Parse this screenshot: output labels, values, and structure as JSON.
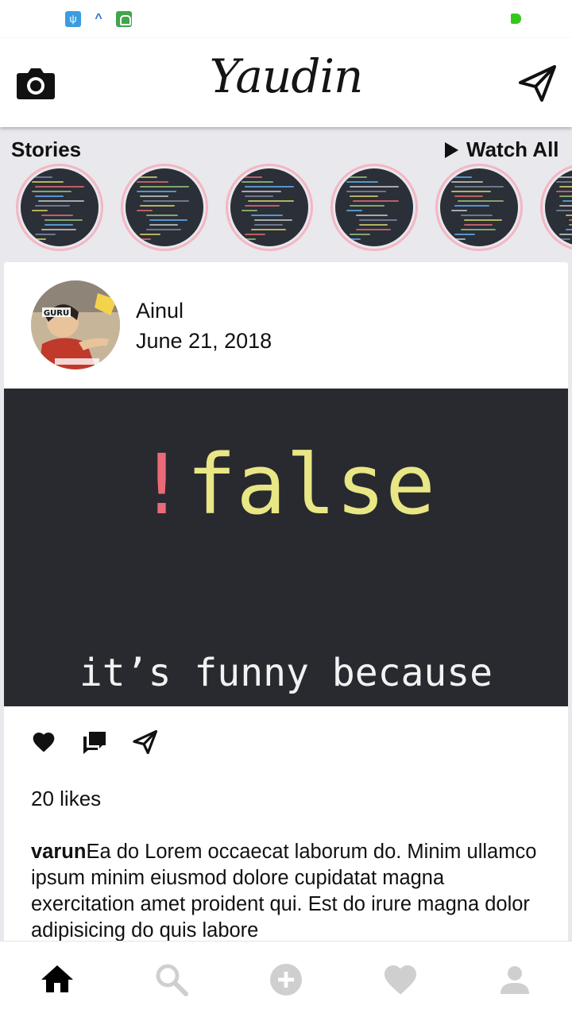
{
  "status_bar": {
    "icons": [
      "usb-icon",
      "caret-up-icon",
      "android-icon",
      "battery-icon"
    ],
    "colors": {
      "usb": "#3b9ce0",
      "android": "#3fa64a",
      "battery": "#34c81e"
    }
  },
  "app_bar": {
    "title": "Yaudin",
    "left_icon": "camera-icon",
    "right_icon": "send-icon"
  },
  "stories": {
    "label": "Stories",
    "watch_all": "Watch All",
    "items": [
      {
        "ring_color": "#f4b6c2"
      },
      {
        "ring_color": "#f4b6c2"
      },
      {
        "ring_color": "#f4b6c2"
      },
      {
        "ring_color": "#f4b6c2"
      },
      {
        "ring_color": "#f4b6c2"
      },
      {
        "ring_color": "#f4b6c2"
      }
    ]
  },
  "post": {
    "author": "Ainul",
    "date": "June 21, 2018",
    "avatar_text": "GURU",
    "image": {
      "bang": "!",
      "main_text": "false",
      "sub_text": "it’s funny because",
      "bg_color": "#282a30"
    },
    "actions": [
      "heart-icon",
      "comment-icon",
      "share-icon"
    ],
    "likes": "20 likes",
    "caption_user": "varun",
    "caption_text": "Ea do Lorem occaecat laborum do. Minim ullamco ipsum minim eiusmod dolore cupidatat magna exercitation amet proident qui. Est do irure magna dolor adipisicing do quis labore"
  },
  "bottom_nav": {
    "items": [
      "home-icon",
      "search-icon",
      "add-icon",
      "heart-icon",
      "profile-icon"
    ],
    "active_color": "#000000",
    "inactive_color": "#cfcfcf"
  }
}
